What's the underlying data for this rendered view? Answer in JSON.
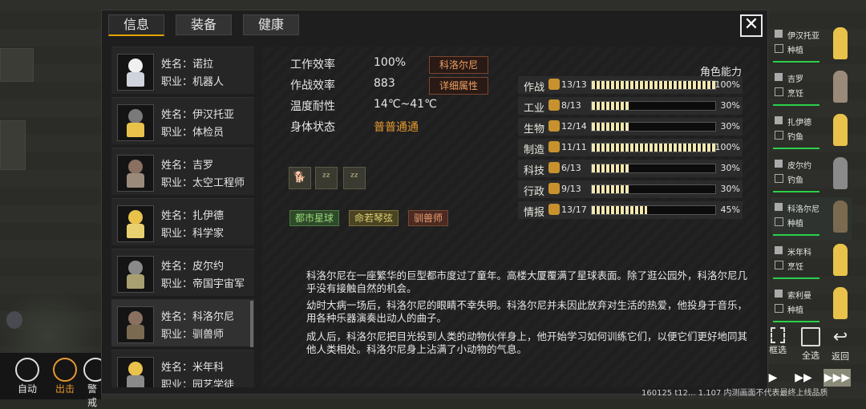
{
  "tabs": [
    "信息",
    "装备",
    "健康"
  ],
  "close_label": "✕",
  "colonists": [
    {
      "name": "姓名：诺拉",
      "job": "职业：机器人",
      "head": "#f0f0f0",
      "body": "#d0d4dc"
    },
    {
      "name": "姓名：伊汉托亚",
      "job": "职业：体检员",
      "head": "#7a7a7a",
      "body": "#e8c24a"
    },
    {
      "name": "姓名：吉罗",
      "job": "职业：太空工程师",
      "head": "#8a7060",
      "body": "#9a8a7a"
    },
    {
      "name": "姓名：扎伊德",
      "job": "职业：科学家",
      "head": "#e8c24a",
      "body": "#e8d070"
    },
    {
      "name": "姓名：皮尔约",
      "job": "职业：帝国宇宙军",
      "head": "#8a8a8a",
      "body": "#a8a070"
    },
    {
      "name": "姓名：科洛尔尼",
      "job": "职业：驯兽师",
      "head": "#8a7060",
      "body": "#7a6a50"
    },
    {
      "name": "姓名：米年科",
      "job": "职业：园艺学徒",
      "head": "#e8c24a",
      "body": "#8a8a8a"
    }
  ],
  "stats": [
    {
      "label": "工作效率",
      "value": "100%"
    },
    {
      "label": "作战效率",
      "value": "883"
    },
    {
      "label": "温度耐性",
      "value": "14℃~41℃"
    },
    {
      "label": "身体状态",
      "value": "普普通通"
    }
  ],
  "pills": {
    "name_pill": "科洛尔尼",
    "detail_pill": "详细属性"
  },
  "status_icons": [
    "dog-icon",
    "sleep-icon",
    "sleep-icon"
  ],
  "traits": [
    {
      "label": "都市星球",
      "bg": "#2e4a2a",
      "color": "#9bd87a",
      "border": "#4b7a40"
    },
    {
      "label": "命若琴弦",
      "bg": "#4a4422",
      "color": "#e0d070",
      "border": "#7a6e38"
    },
    {
      "label": "驯兽师",
      "bg": "#4a2a22",
      "color": "#f0a070",
      "border": "#7a4630"
    }
  ],
  "story": [
    "科洛尔尼在一座繁华的巨型都市度过了童年。高楼大厦覆满了星球表面。除了逛公园外，科洛尔尼几乎没有接触自然的机会。",
    "幼时大病一场后，科洛尔尼的眼睛不幸失明。科洛尔尼并未因此放弃对生活的热爱，他投身于音乐，用各种乐器演奏出动人的曲子。",
    "成人后，科洛尔尼把目光投到人类的动物伙伴身上，他开始学习如何训练它们，以便它们更好地同其他人类相处。科洛尔尼身上沾满了小动物的气息。"
  ],
  "abilities_title": "角色能力",
  "abilities": [
    {
      "label": "作战",
      "count": "13/13",
      "pct": "100%",
      "level": 1.0
    },
    {
      "label": "工业",
      "count": "8/13",
      "pct": "30%",
      "level": 0.3
    },
    {
      "label": "生物",
      "count": "12/14",
      "pct": "30%",
      "level": 0.3
    },
    {
      "label": "制造",
      "count": "11/11",
      "pct": "100%",
      "level": 1.0
    },
    {
      "label": "科技",
      "count": "6/13",
      "pct": "30%",
      "level": 0.3
    },
    {
      "label": "行政",
      "count": "9/13",
      "pct": "30%",
      "level": 0.3
    },
    {
      "label": "情报",
      "count": "13/17",
      "pct": "45%",
      "level": 0.45
    }
  ],
  "right_panel": [
    {
      "name": "伊汉托亚",
      "task": "种植",
      "fig": "#e8c24a"
    },
    {
      "name": "吉罗",
      "task": "烹饪",
      "fig": "#9a8a7a"
    },
    {
      "name": "扎伊德",
      "task": "钓鱼",
      "fig": "#e8c24a"
    },
    {
      "name": "皮尔约",
      "task": "钓鱼",
      "fig": "#8a8a8a"
    },
    {
      "name": "科洛尔尼",
      "task": "种植",
      "fig": "#7a6a50"
    },
    {
      "name": "米年科",
      "task": "烹饪",
      "fig": "#e8c24a"
    },
    {
      "name": "索利曼",
      "task": "种植",
      "fig": "#e8c24a"
    }
  ],
  "bottom_left": [
    {
      "label": "自动"
    },
    {
      "label": "出击"
    },
    {
      "label": "警戒"
    }
  ],
  "side_buttons": {
    "select_all": "全选",
    "back": "返回",
    "frame": "框选"
  },
  "speed_buttons": [
    "▶",
    "▶▶",
    "▶▶▶"
  ],
  "status_text": "160125 t12... 1.107 内测画面不代表最终上线品质"
}
